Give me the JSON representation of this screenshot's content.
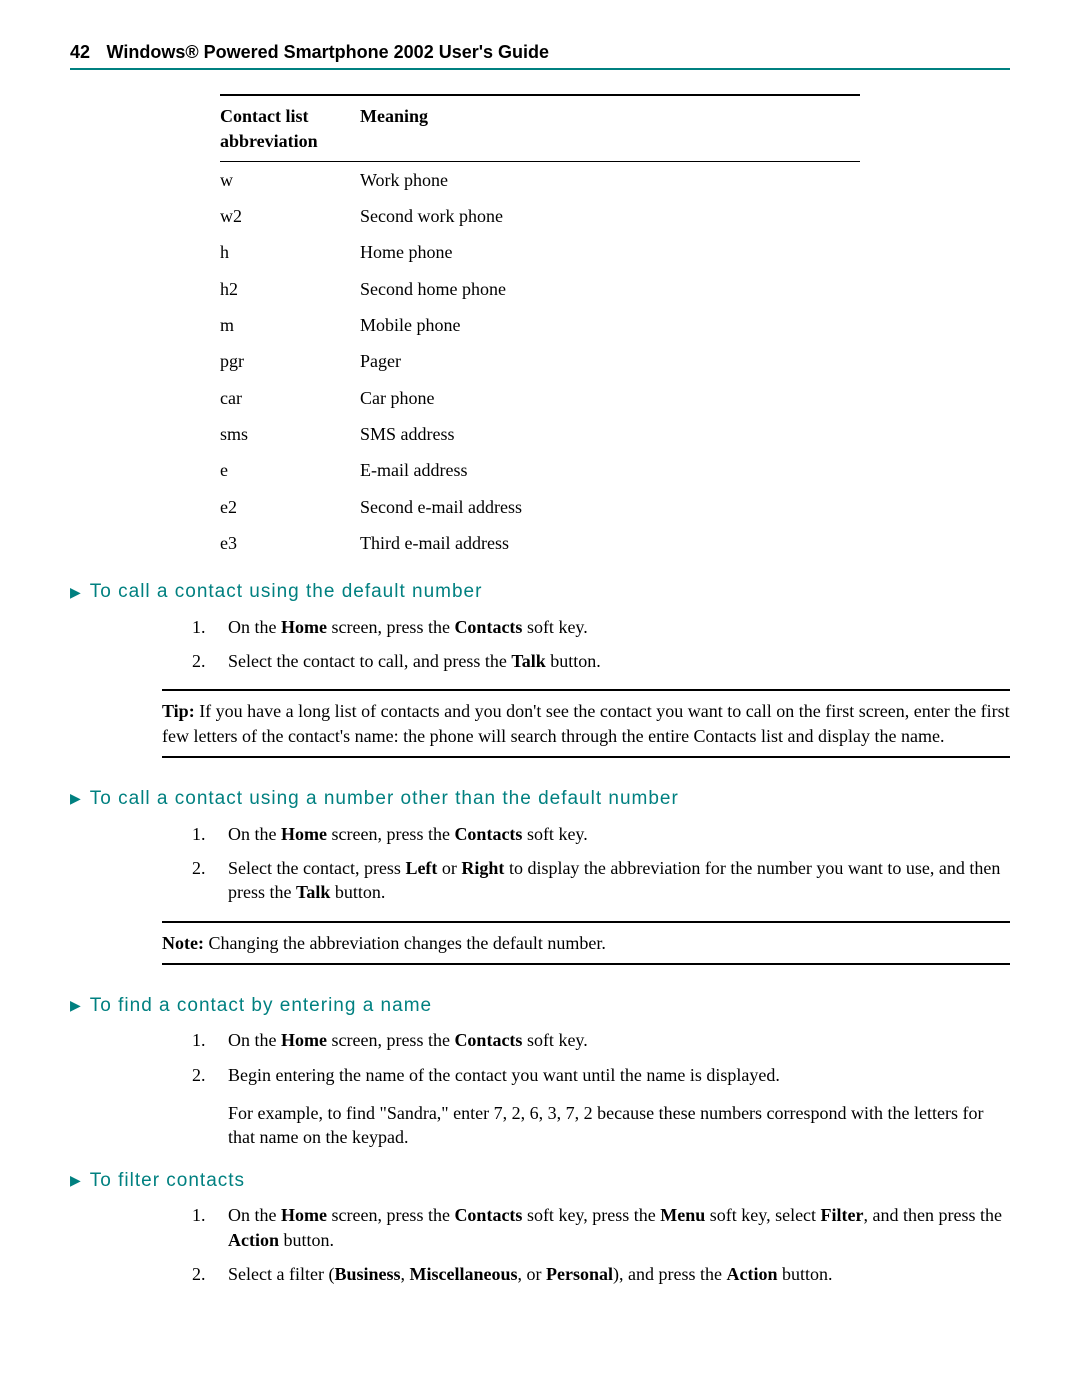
{
  "header": {
    "page_number": "42",
    "doc_title": "Windows® Powered Smartphone 2002 User's Guide"
  },
  "table": {
    "col1_line1": "Contact list",
    "col1_line2": "abbreviation",
    "col2": "Meaning",
    "rows": [
      {
        "abbr": "w",
        "meaning": "Work phone"
      },
      {
        "abbr": "w2",
        "meaning": "Second work phone"
      },
      {
        "abbr": "h",
        "meaning": "Home phone"
      },
      {
        "abbr": "h2",
        "meaning": "Second home phone"
      },
      {
        "abbr": "m",
        "meaning": "Mobile phone"
      },
      {
        "abbr": "pgr",
        "meaning": "Pager"
      },
      {
        "abbr": "car",
        "meaning": "Car phone"
      },
      {
        "abbr": "sms",
        "meaning": "SMS address"
      },
      {
        "abbr": "e",
        "meaning": "E-mail address"
      },
      {
        "abbr": "e2",
        "meaning": "Second e-mail address"
      },
      {
        "abbr": "e3",
        "meaning": "Third e-mail address"
      }
    ]
  },
  "sections": {
    "s1": {
      "title": "To call a contact using the default number",
      "step1_a": "On the ",
      "step1_b": "Home",
      "step1_c": " screen, press the ",
      "step1_d": "Contacts",
      "step1_e": " soft key.",
      "step2_a": "Select the contact to call, and press the ",
      "step2_b": "Talk",
      "step2_c": " button."
    },
    "tip": {
      "label": "Tip:",
      "text": "  If you have a long list of contacts and you don't see the contact you want to call on the first screen, enter the first few letters of the contact's name: the phone will search through the entire Contacts list and display the name."
    },
    "s2": {
      "title": "To call a contact using a number other than the default number",
      "step1_a": "On the ",
      "step1_b": "Home",
      "step1_c": " screen, press the ",
      "step1_d": "Contacts",
      "step1_e": " soft key.",
      "step2_a": "Select the contact, press ",
      "step2_b": "Left",
      "step2_c": " or ",
      "step2_d": "Right",
      "step2_e": " to display the abbreviation for the number you want to use, and then press the ",
      "step2_f": "Talk",
      "step2_g": " button."
    },
    "note": {
      "label": "Note:",
      "text": " Changing the abbreviation changes the default number."
    },
    "s3": {
      "title": "To find a contact by entering a name",
      "step1_a": "On the ",
      "step1_b": "Home",
      "step1_c": " screen, press the ",
      "step1_d": "Contacts",
      "step1_e": " soft key.",
      "step2": "Begin entering the name of the contact you want until the name is displayed.",
      "example": "For example, to find \"Sandra,\" enter 7, 2, 6, 3, 7, 2 because these numbers correspond with the letters for that name on the keypad."
    },
    "s4": {
      "title": "To filter contacts",
      "step1_a": "On the ",
      "step1_b": "Home",
      "step1_c": " screen, press the ",
      "step1_d": "Contacts",
      "step1_e": " soft key, press the ",
      "step1_f": "Menu",
      "step1_g": " soft key, select ",
      "step1_h": "Filter",
      "step1_i": ", and then press the ",
      "step1_j": "Action",
      "step1_k": " button.",
      "step2_a": "Select a filter (",
      "step2_b": "Business",
      "step2_c": ", ",
      "step2_d": "Miscellaneous",
      "step2_e": ", or ",
      "step2_f": "Personal",
      "step2_g": "), and press the ",
      "step2_h": "Action",
      "step2_i": " button."
    }
  }
}
